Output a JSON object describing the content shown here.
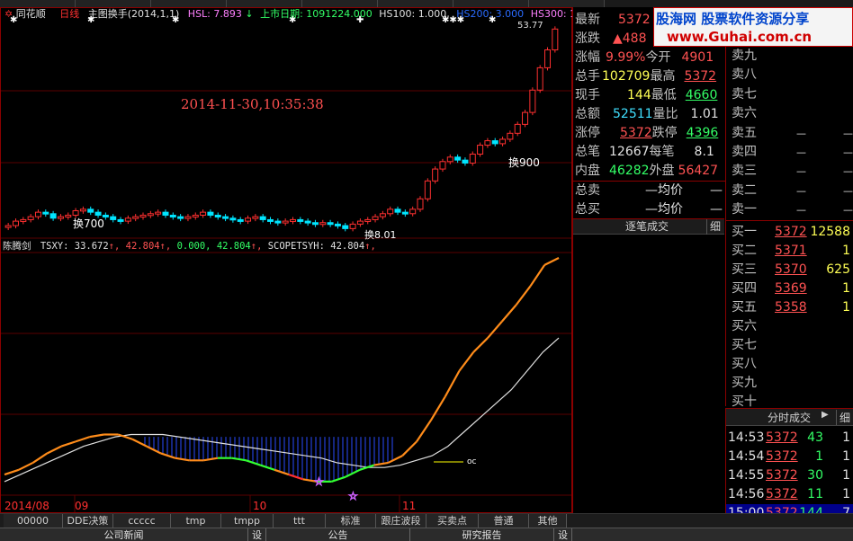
{
  "app": {
    "title": "同花顺"
  },
  "header": {
    "period": "日线",
    "indicator": "主图换手(2014,1,1)",
    "hsl_label": "HSL: 7.893",
    "hsl_arrow": "↓",
    "listing_label": "上市日期: 1091224.000",
    "hs100": "HS100: 1.000,",
    "hs200": "HS200: 3.000",
    "hs300": "HS300: 1"
  },
  "chart": {
    "timestamp": "2014-11-30,10:35:38",
    "price_top": "53.77",
    "annot_huan700": "换700",
    "annot_huan900": "换900",
    "annot_low": "换8.01",
    "sub_title": "陈腾剑",
    "sub_formula": "TSXY: 33.672",
    "sub_v1": "42.804",
    "sub_v2": "0.000, 42.804",
    "sub_v3": "SCOPETSYH: 42.804",
    "oc_label": "oc",
    "x_ticks": [
      "2014/08",
      "09",
      "10",
      "11"
    ],
    "candles": [
      4.2,
      4.5,
      4.6,
      4.8,
      5.1,
      5.0,
      4.7,
      4.8,
      4.9,
      5.2,
      5.3,
      5.1,
      4.9,
      4.8,
      4.6,
      4.5,
      4.7,
      4.8,
      4.9,
      5.0,
      5.1,
      4.9,
      4.8,
      4.7,
      4.8,
      4.9,
      5.1,
      4.9,
      4.8,
      4.7,
      4.6,
      4.5,
      4.7,
      4.8,
      4.6,
      4.5,
      4.4,
      4.5,
      4.6,
      4.5,
      4.4,
      4.3,
      4.4,
      4.3,
      4.2,
      4.0,
      4.3,
      4.5,
      4.6,
      4.8,
      5.0,
      5.3,
      5.1,
      5.0,
      5.3,
      6.0,
      7.2,
      8.0,
      8.5,
      8.8,
      8.6,
      8.4,
      9.0,
      9.6,
      9.9,
      9.7,
      10.0,
      10.4,
      11.0,
      11.8,
      13.3,
      14.8,
      16.0,
      17.4
    ],
    "orange_line": [
      0.08,
      0.1,
      0.13,
      0.17,
      0.2,
      0.22,
      0.24,
      0.25,
      0.25,
      0.23,
      0.2,
      0.17,
      0.15,
      0.14,
      0.14,
      0.15,
      0.15,
      0.14,
      0.12,
      0.1,
      0.08,
      0.06,
      0.05,
      0.05,
      0.07,
      0.1,
      0.12,
      0.13,
      0.16,
      0.22,
      0.31,
      0.41,
      0.52,
      0.6,
      0.66,
      0.73,
      0.8,
      0.88,
      0.97,
      1.0
    ],
    "white_line": [
      0.05,
      0.08,
      0.11,
      0.14,
      0.17,
      0.2,
      0.22,
      0.24,
      0.25,
      0.25,
      0.25,
      0.24,
      0.23,
      0.22,
      0.21,
      0.2,
      0.19,
      0.18,
      0.17,
      0.16,
      0.15,
      0.13,
      0.12,
      0.11,
      0.11,
      0.12,
      0.14,
      0.16,
      0.2,
      0.26,
      0.32,
      0.38,
      0.44,
      0.52,
      0.6,
      0.66
    ]
  },
  "quote": {
    "zuixin_lbl": "最新",
    "zuixin": "5372",
    "zhangdie_lbl": "涨跌",
    "zhangdie": "▲488",
    "zhangfu_lbl": "涨幅",
    "zhangfu": "9.99%",
    "jinkai_lbl": "今开",
    "jinkai": "4901",
    "zongshou_lbl": "总手",
    "zongshou": "102709",
    "zuigao_lbl": "最高",
    "zuigao": "5372",
    "xianshou_lbl": "现手",
    "xianshou": "144",
    "zuidi_lbl": "最低",
    "zuidi": "4660",
    "zonge_lbl": "总额",
    "zonge": "52511",
    "liangbi_lbl": "量比",
    "liangbi": "1.01",
    "zhangting_lbl": "涨停",
    "zhangting": "5372",
    "dieting_lbl": "跌停",
    "dieting": "4396",
    "zongbi_lbl": "总笔",
    "zongbi": "12667",
    "meibi_lbl": "每笔",
    "meibi": "8.1",
    "neipan_lbl": "内盘",
    "neipan": "46282",
    "waipan_lbl": "外盘",
    "waipan": "56427",
    "zongmai_lbl": "总卖",
    "zongmai_avg": "—均价",
    "zongmai_dash": "—",
    "zongmai2_lbl": "总买",
    "zongmai2_avg": "—均价",
    "zongmai2_dash": "—",
    "zhubi": "逐笔成交",
    "xi": "细"
  },
  "sell_book": [
    "卖九",
    "卖八",
    "卖七",
    "卖六",
    "卖五",
    "卖四",
    "卖三",
    "卖二",
    "卖一"
  ],
  "sell_dash": "—",
  "buy_book": [
    {
      "label": "买一",
      "price": "5372",
      "vol": "12588"
    },
    {
      "label": "买二",
      "price": "5371",
      "vol": "1"
    },
    {
      "label": "买三",
      "price": "5370",
      "vol": "625"
    },
    {
      "label": "买四",
      "price": "5369",
      "vol": "1"
    },
    {
      "label": "买五",
      "price": "5358",
      "vol": "1"
    },
    {
      "label": "买六",
      "price": "",
      "vol": ""
    },
    {
      "label": "买七",
      "price": "",
      "vol": ""
    },
    {
      "label": "买八",
      "price": "",
      "vol": ""
    },
    {
      "label": "买九",
      "price": "",
      "vol": ""
    },
    {
      "label": "买十",
      "price": "",
      "vol": ""
    }
  ],
  "ticks": {
    "title": "分时成交",
    "nav": "▶",
    "xi": "细",
    "rows": [
      {
        "time": "14:53",
        "price": "5372",
        "vol": "43",
        "n": "1"
      },
      {
        "time": "14:54",
        "price": "5372",
        "vol": "1",
        "n": "1"
      },
      {
        "time": "14:55",
        "price": "5372",
        "vol": "30",
        "n": "1"
      },
      {
        "time": "14:56",
        "price": "5372",
        "vol": "11",
        "n": "1"
      },
      {
        "time": "15:00",
        "price": "5372",
        "vol": "144",
        "n": "7"
      }
    ]
  },
  "logo": {
    "line1": "股海网 股票软件资源分享",
    "line2": "www.Guhai.com.cn"
  },
  "tabs": [
    "00000",
    "DDE决策",
    "ccccc",
    "tmp",
    "tmpp",
    "ttt",
    "标准",
    "跟庄波段",
    "买卖点",
    "普通",
    "其他"
  ],
  "bottom": {
    "news": "公司新闻",
    "set1": "设",
    "notice": "公告",
    "set2": "设",
    "report": "研究报告",
    "set3": "设"
  },
  "colors": {
    "red": "#ff3030",
    "cyan": "#00e5ff",
    "orange": "#ff8c1a",
    "green": "#33ff33"
  }
}
